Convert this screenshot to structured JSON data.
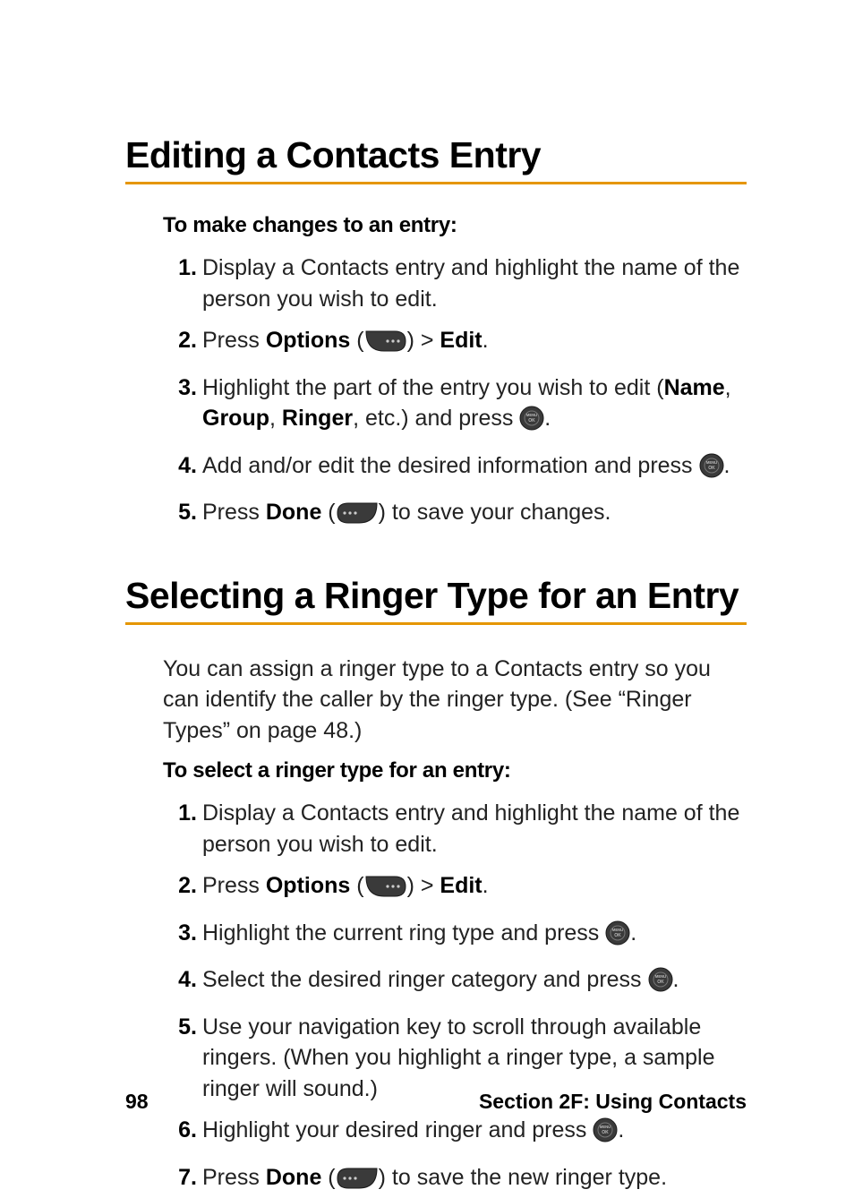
{
  "section1": {
    "title": "Editing a Contacts Entry",
    "leadin": "To make changes to an entry:",
    "steps": [
      {
        "num": "1.",
        "pre": "Display a Contacts entry and highlight the name of the person you wish to edit."
      },
      {
        "num": "2.",
        "pre": "Press ",
        "b1": "Options",
        "mid1": " (",
        "icon1": "softkey-right",
        "mid2": ") > ",
        "b2": "Edit",
        "post": "."
      },
      {
        "num": "3.",
        "pre": "Highlight the part of the entry you wish to edit (",
        "b1": "Name",
        "mid1": ", ",
        "b2": "Group",
        "mid2": ", ",
        "b3": "Ringer",
        "mid3": ", etc.) and press ",
        "icon1": "menu-ok",
        "post": "."
      },
      {
        "num": "4.",
        "pre": "Add and/or edit the desired information and press ",
        "icon1": "menu-ok",
        "post": "."
      },
      {
        "num": "5.",
        "pre": "Press ",
        "b1": "Done",
        "mid1": " (",
        "icon1": "softkey-left",
        "mid2": ") to save your changes."
      }
    ]
  },
  "section2": {
    "title": "Selecting a Ringer Type for an Entry",
    "body": "You  can assign a ringer type to a Contacts entry so you can identify the caller by the ringer type. (See “Ringer Types” on page 48.)",
    "leadin": "To select a ringer type for an entry:",
    "steps": [
      {
        "num": "1.",
        "pre": "Display a Contacts entry and highlight the name of the person you wish to edit."
      },
      {
        "num": "2.",
        "pre": "Press ",
        "b1": "Options",
        "mid1": " (",
        "icon1": "softkey-right",
        "mid2": ") > ",
        "b2": "Edit",
        "post": "."
      },
      {
        "num": "3.",
        "pre": "Highlight the current ring type and press ",
        "icon1": "menu-ok",
        "post": "."
      },
      {
        "num": "4.",
        "pre": "Select the desired ringer category and press ",
        "icon1": "menu-ok",
        "post": "."
      },
      {
        "num": "5.",
        "pre": "Use your navigation key to scroll through available ringers. (When you highlight a ringer type, a sample ringer will sound.)"
      },
      {
        "num": "6.",
        "pre": "Highlight your desired ringer and press ",
        "icon1": "menu-ok",
        "post": "."
      },
      {
        "num": "7.",
        "pre": "Press ",
        "b1": "Done",
        "mid1": " (",
        "icon1": "softkey-left",
        "mid2": ") to save the new ringer type."
      }
    ]
  },
  "footer": {
    "page": "98",
    "section": "Section 2F: Using Contacts"
  }
}
